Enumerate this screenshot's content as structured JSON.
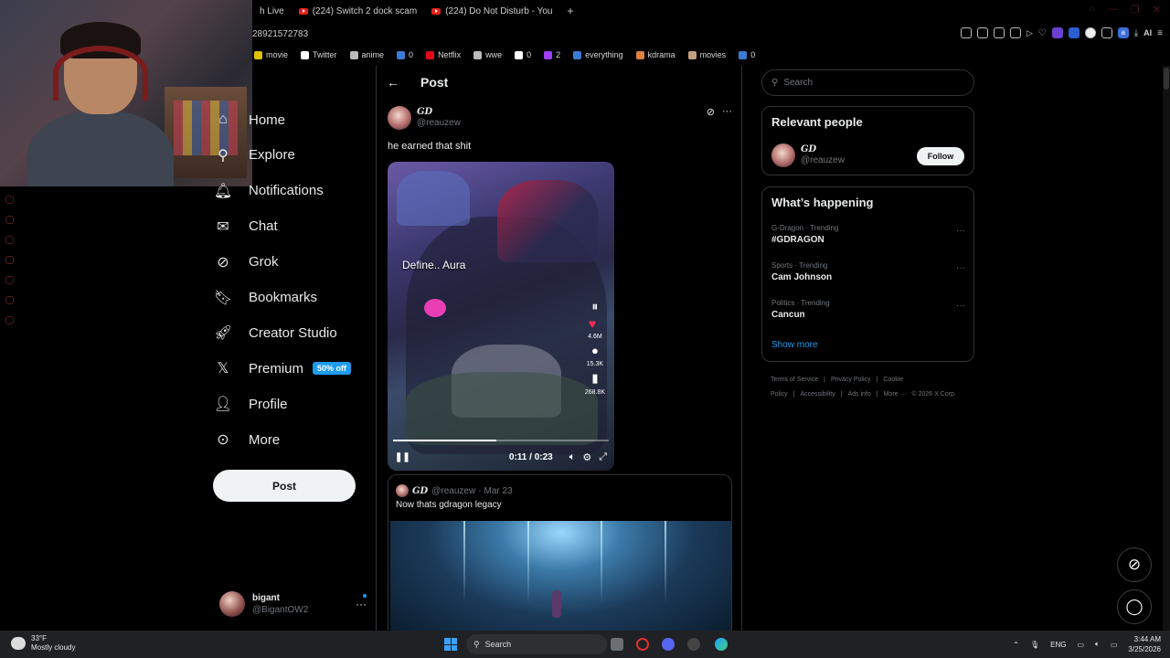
{
  "browser": {
    "tabs": [
      {
        "label": "h Live"
      },
      {
        "label": "(224) Switch 2 dock scam"
      },
      {
        "label": "(224) Do Not Disturb - You"
      }
    ],
    "new_tab_label": "+",
    "address_text": "28921572783",
    "bookmarks": [
      {
        "label": "movie",
        "color": "#e0c000"
      },
      {
        "label": "Twitter",
        "color": "#ffffff"
      },
      {
        "label": "anime",
        "color": "#bbbbbb"
      },
      {
        "label": "0",
        "color": "#3a7bd5"
      },
      {
        "label": "Netflix",
        "color": "#e50914"
      },
      {
        "label": "wwe",
        "color": "#bbbbbb"
      },
      {
        "label": "0",
        "color": "#ffffff"
      },
      {
        "label": "2",
        "color": "#a040ff"
      },
      {
        "label": "everything",
        "color": "#3a7bd5"
      },
      {
        "label": "kdrama",
        "color": "#e08040"
      },
      {
        "label": "movies",
        "color": "#c0a080"
      },
      {
        "label": "0",
        "color": "#3a7bd5"
      }
    ],
    "ext_ai_label": "AI"
  },
  "nav": {
    "items": [
      {
        "label": "Home",
        "icon": "home-icon"
      },
      {
        "label": "Explore",
        "icon": "search-icon"
      },
      {
        "label": "Notifications",
        "icon": "bell-icon"
      },
      {
        "label": "Chat",
        "icon": "mail-icon"
      },
      {
        "label": "Grok",
        "icon": "grok-icon"
      },
      {
        "label": "Bookmarks",
        "icon": "bookmark-icon"
      },
      {
        "label": "Creator Studio",
        "icon": "rocket-icon"
      },
      {
        "label": "Premium",
        "icon": "x-logo-icon"
      },
      {
        "label": "Profile",
        "icon": "person-icon"
      },
      {
        "label": "More",
        "icon": "more-circle-icon"
      }
    ],
    "premium_badge": "50% off",
    "post_button": "Post",
    "account": {
      "name": "bigant",
      "handle": "@BigantOW2"
    }
  },
  "post": {
    "title": "Post",
    "author_name": "GD",
    "author_handle": "@reauzew",
    "text": "he earned that shit",
    "video": {
      "caption": "Define.. Aura",
      "likes": "4.6M",
      "comments": "15.3K",
      "saves": "268.8K",
      "time": "0:11 / 0:23",
      "progress": 0.48
    },
    "quote": {
      "author_name": "GD",
      "author_handle": "@reauzew",
      "date": "Mar 23",
      "text": "Now thats gdragon legacy"
    }
  },
  "sidebar": {
    "search_placeholder": "Search",
    "relevant_title": "Relevant people",
    "relevant_person": {
      "name": "GD",
      "handle": "@reauzew",
      "follow_label": "Follow"
    },
    "happening_title": "What’s happening",
    "trends": [
      {
        "meta": "G-Dragon · Trending",
        "name": "#GDRAGON"
      },
      {
        "meta": "Sports · Trending",
        "name": "Cam Johnson"
      },
      {
        "meta": "Politics · Trending",
        "name": "Cancun"
      }
    ],
    "show_more": "Show more",
    "footer": [
      "Terms of Service",
      "|",
      "Privacy Policy",
      "|",
      "Cookie Policy",
      "|",
      "Accessibility",
      "|",
      "Ads info",
      "|",
      "More ···",
      "© 2026 X Corp."
    ]
  },
  "taskbar": {
    "temperature": "33°F",
    "weather": "Mostly cloudy",
    "search_label": "Search",
    "language": "ENG",
    "time": "3:44 AM",
    "date": "3/25/2026"
  },
  "colors": {
    "accent": "#1d9bf0",
    "like": "#ff2d55",
    "background": "#000000"
  }
}
